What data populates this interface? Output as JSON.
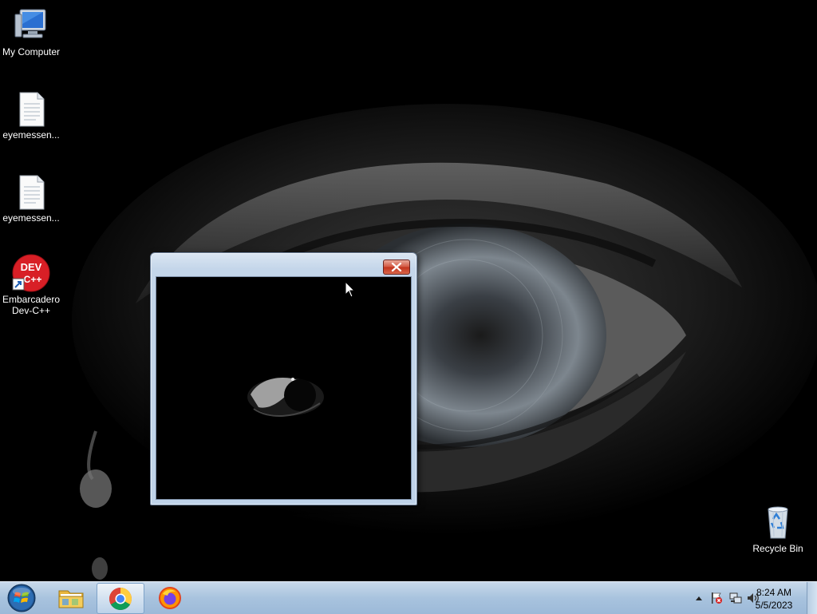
{
  "desktop": {
    "icons": [
      {
        "label": "My Computer",
        "icon": "computer-icon"
      },
      {
        "label": "eyemessen...",
        "icon": "text-file-icon"
      },
      {
        "label": "eyemessen...",
        "icon": "text-file-icon"
      },
      {
        "label": "Embarcadero Dev-C++",
        "icon": "devcpp-icon",
        "badge": "DEV\nC++"
      },
      {
        "label": "Recycle Bin",
        "icon": "recycle-bin-icon"
      }
    ],
    "devcpp_badge_line1": "DEV",
    "devcpp_badge_line2": "C++"
  },
  "window": {
    "title": "",
    "close_icon": "close-icon"
  },
  "taskbar": {
    "start_icon": "windows-start-orb-icon",
    "pinned": [
      {
        "name": "file-explorer",
        "icon": "folder-icon",
        "active": false
      },
      {
        "name": "google-chrome",
        "icon": "chrome-icon",
        "active": true
      },
      {
        "name": "firefox",
        "icon": "firefox-icon",
        "active": false
      }
    ],
    "tray": {
      "icons": [
        "show-hidden-icons-icon",
        "action-center-flag-icon",
        "network-icon",
        "volume-icon"
      ],
      "time": "8:24 AM",
      "date": "5/5/2023"
    }
  },
  "colors": {
    "taskbar": "#a8c3de",
    "window_frame": "#c4d6ea",
    "close_button": "#c2321c",
    "desktop_bg": "#000000"
  }
}
